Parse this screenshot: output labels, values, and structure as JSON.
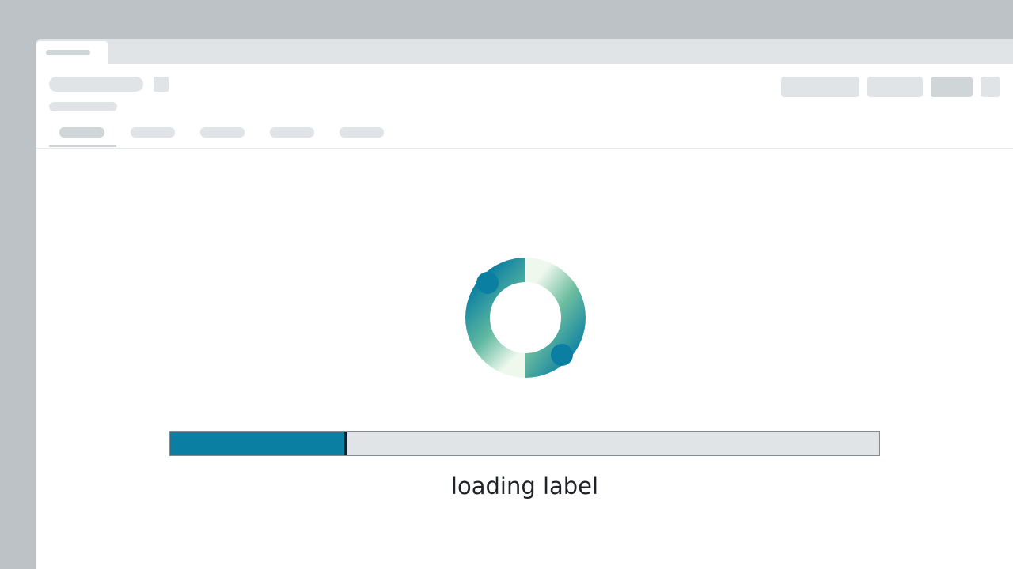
{
  "loading": {
    "label": "loading label",
    "progress_fraction": 0.25
  },
  "colors": {
    "accent": "#0a7fa2",
    "spinner_gradient_start": "#0a7fa2",
    "spinner_gradient_end": "#e8f5e6",
    "skeleton": "#e1e4e6",
    "frame": "#bcc2c5"
  },
  "icons": {
    "spinner": "loading-spinner-icon"
  }
}
